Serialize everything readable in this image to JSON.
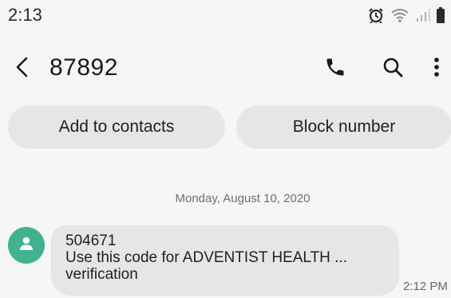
{
  "status_bar": {
    "time": "2:13",
    "icons": [
      "alarm-icon",
      "wifi-icon",
      "signal-icon",
      "battery-icon"
    ]
  },
  "app_bar": {
    "title": "87892",
    "icons": [
      "back-icon",
      "phone-icon",
      "search-icon",
      "more-vert-icon"
    ]
  },
  "actions": {
    "add_to_contacts": "Add to contacts",
    "block_number": "Block number"
  },
  "conversation": {
    "date_divider": "Monday, August 10, 2020",
    "messages": [
      {
        "lines": [
          "504671",
          "Use this code for ADVENTIST HEALTH ...",
          "verification"
        ],
        "time": "2:12 PM",
        "avatar_icon": "person-icon"
      }
    ]
  },
  "colors": {
    "background": "#f6f6f6",
    "pill": "#e6e6e6",
    "bubble": "#e6e6e6",
    "avatar": "#3fb38f"
  }
}
